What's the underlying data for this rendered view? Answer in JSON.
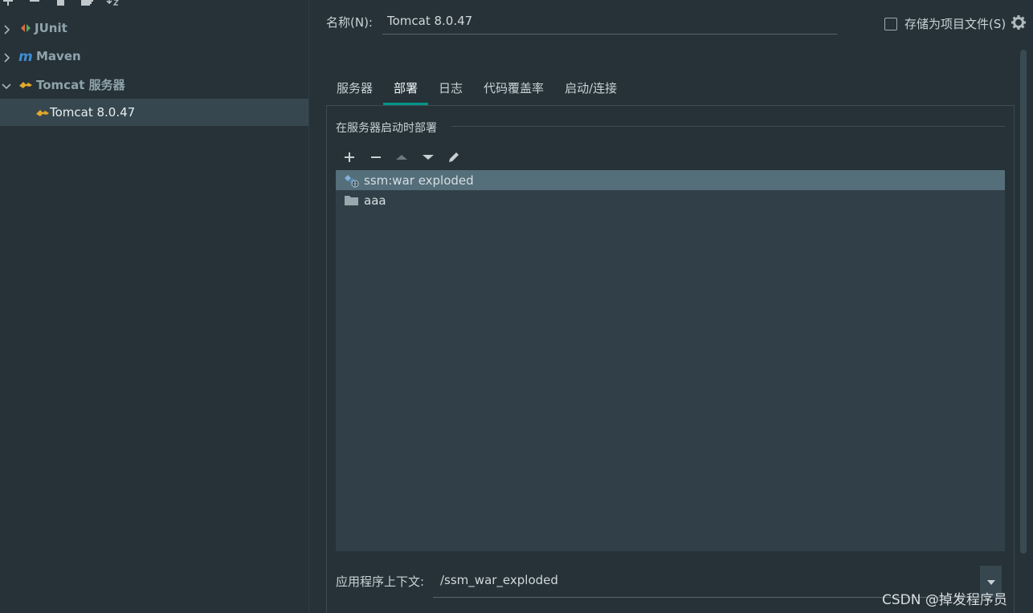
{
  "sidebar": {
    "toolbar_icons": [
      "add-icon",
      "remove-icon",
      "copy-icon",
      "new-folder-icon",
      "sort-icon"
    ],
    "items": [
      {
        "label": "JUnit",
        "icon": "junit-icon",
        "expanded": false
      },
      {
        "label": "Maven",
        "icon": "maven-icon",
        "expanded": false
      },
      {
        "label": "Tomcat 服务器",
        "icon": "tomcat-icon",
        "expanded": true
      },
      {
        "label": "Tomcat 8.0.47",
        "icon": "tomcat-icon",
        "selected": true
      }
    ]
  },
  "header": {
    "name_label": "名称(N):",
    "name_value": "Tomcat 8.0.47",
    "store_label": "存储为项目文件(S)",
    "store_checked": false
  },
  "tabs": [
    {
      "label": "服务器",
      "active": false
    },
    {
      "label": "部署",
      "active": true
    },
    {
      "label": "日志",
      "active": false
    },
    {
      "label": "代码覆盖率",
      "active": false
    },
    {
      "label": "启动/连接",
      "active": false
    }
  ],
  "deploy": {
    "section_title": "在服务器启动时部署",
    "toolbar_icons": [
      "add-icon",
      "remove-icon",
      "move-up-icon",
      "move-down-icon",
      "edit-icon"
    ],
    "items": [
      {
        "label": "ssm:war exploded",
        "icon": "artifact-icon",
        "selected": true
      },
      {
        "label": "aaa",
        "icon": "folder-icon",
        "selected": false
      }
    ],
    "context_label": "应用程序上下文:",
    "context_value": "/ssm_war_exploded"
  },
  "watermark": "CSDN @掉发程序员",
  "colors": {
    "background": "#263238",
    "selected_row": "#546e7a",
    "tab_accent": "#009688",
    "list_bg": "#314048"
  }
}
